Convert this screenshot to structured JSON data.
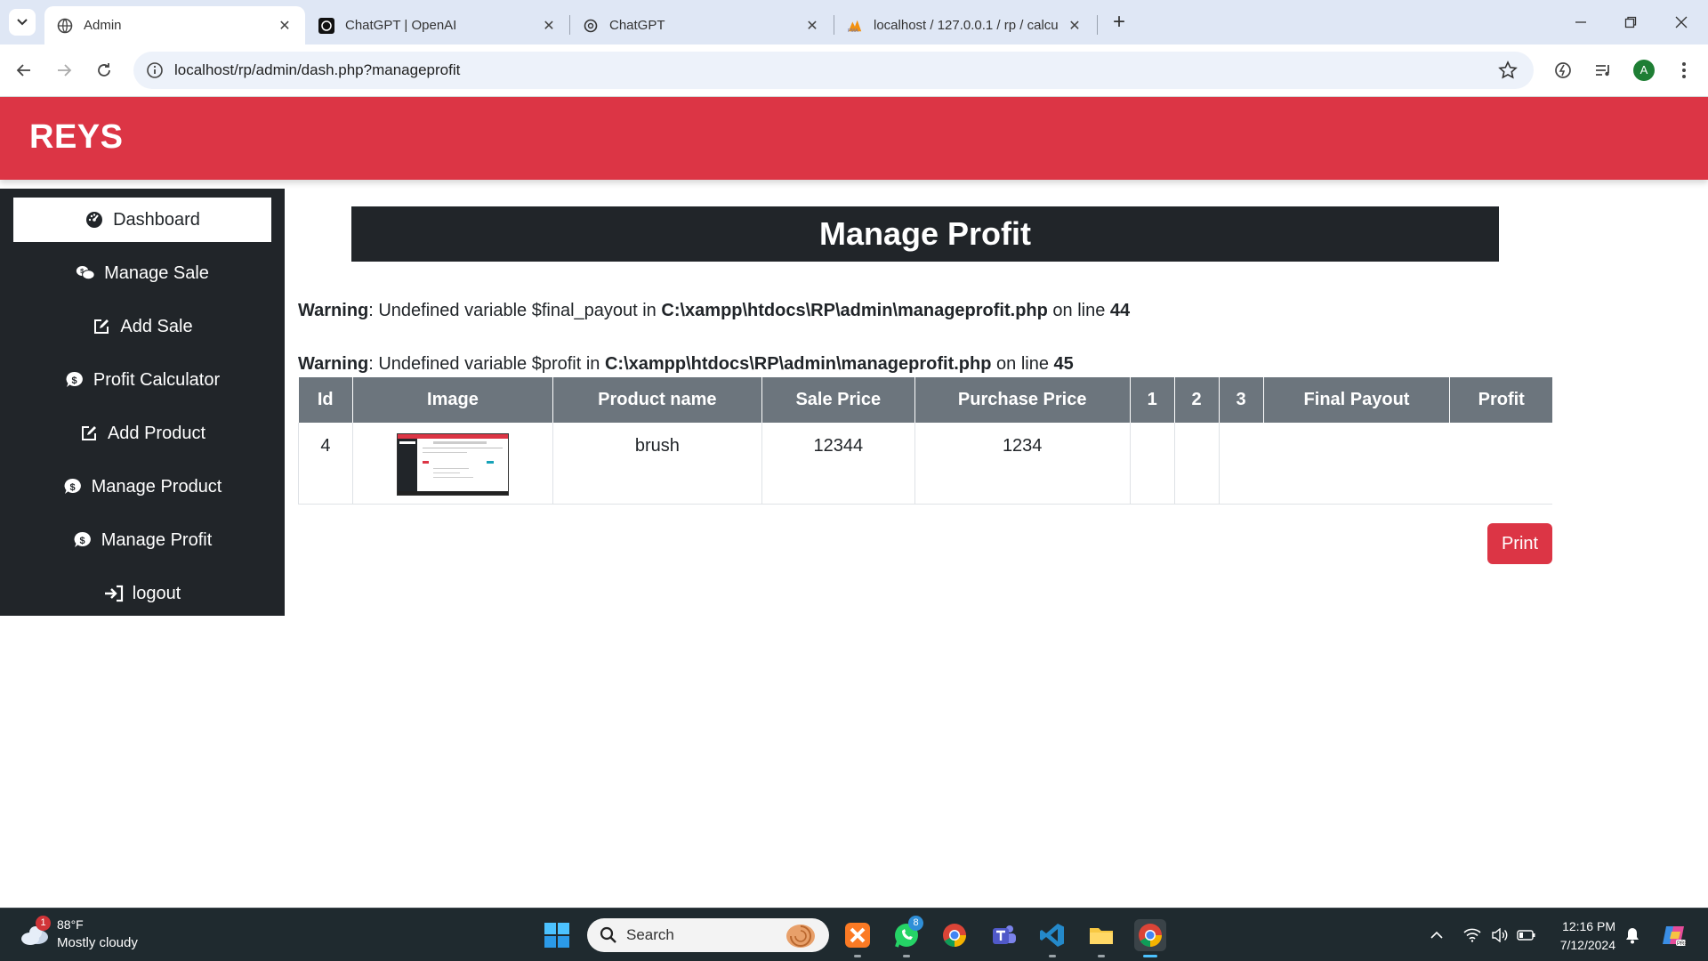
{
  "browser": {
    "tabs": [
      {
        "label": "Admin",
        "active": true,
        "icon": "globe-icon"
      },
      {
        "label": "ChatGPT | OpenAI",
        "active": false,
        "icon": "openai-icon"
      },
      {
        "label": "ChatGPT",
        "active": false,
        "icon": "openai-icon"
      },
      {
        "label": "localhost / 127.0.0.1 / rp / calcu",
        "active": false,
        "icon": "phpmyadmin-icon"
      }
    ],
    "url": "localhost/rp/admin/dash.php?manageprofit",
    "profile_initial": "A"
  },
  "app": {
    "brand": "REYS",
    "accent_color": "#dc3545",
    "sidebar": {
      "items": [
        {
          "label": "Dashboard",
          "icon": "dashboard-icon",
          "active": true
        },
        {
          "label": "Manage Sale",
          "icon": "sale-chat-icon",
          "active": false
        },
        {
          "label": "Add Sale",
          "icon": "edit-icon",
          "active": false
        },
        {
          "label": "Profit Calculator",
          "icon": "dollar-chat-icon",
          "active": false
        },
        {
          "label": "Add Product",
          "icon": "edit-icon",
          "active": false
        },
        {
          "label": "Manage Product",
          "icon": "dollar-chat-icon",
          "active": false
        },
        {
          "label": "Manage Profit",
          "icon": "dollar-chat-icon",
          "active": false
        },
        {
          "label": "logout",
          "icon": "logout-icon",
          "active": false
        }
      ]
    },
    "page_title": "Manage Profit",
    "warnings": [
      {
        "label": "Warning",
        "text_before": ": Undefined variable $final_payout in ",
        "path": "C:\\xampp\\htdocs\\RP\\admin\\manageprofit.php",
        "text_mid": " on line ",
        "line": "44"
      },
      {
        "label": "Warning",
        "text_before": ": Undefined variable $profit in ",
        "path": "C:\\xampp\\htdocs\\RP\\admin\\manageprofit.php",
        "text_mid": " on line ",
        "line": "45"
      }
    ],
    "table": {
      "headers": [
        "Id",
        "Image",
        "Product name",
        "Sale Price",
        "Purchase Price",
        "1",
        "2",
        "3",
        "Final Payout",
        "Profit"
      ],
      "rows": [
        {
          "id": "4",
          "product_name": "brush",
          "sale_price": "12344",
          "purchase_price": "1234",
          "c1": "",
          "c2": "",
          "c3": "",
          "final_payout": "",
          "profit": ""
        }
      ]
    },
    "print_label": "Print"
  },
  "taskbar": {
    "weather_temp": "88°F",
    "weather_desc": "Mostly cloudy",
    "weather_badge": "1",
    "search_placeholder": "Search",
    "whatsapp_badge": "8",
    "time": "12:16 PM",
    "date": "7/12/2024"
  }
}
